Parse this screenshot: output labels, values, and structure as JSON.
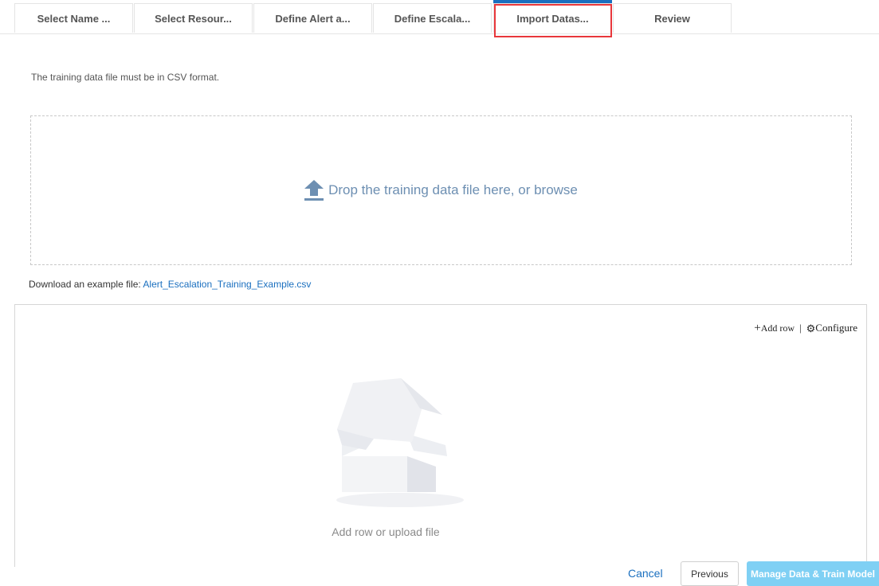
{
  "wizard": {
    "steps": [
      {
        "label": "Select Name ..."
      },
      {
        "label": "Select Resour..."
      },
      {
        "label": "Define Alert a..."
      },
      {
        "label": "Define Escala..."
      },
      {
        "label": "Import Datas..."
      },
      {
        "label": "Review"
      }
    ],
    "active_step": 5
  },
  "import": {
    "format_hint": "The training data file must be in CSV format.",
    "dropzone_text": "Drop the training data file here, or browse",
    "download_prefix": "Download an example file: ",
    "download_link": "Alert_Escalation_Training_Example.csv"
  },
  "grid": {
    "add_row_label": "Add row",
    "separator": "|",
    "configure_label": "Configure",
    "empty_text": "Add row or upload file"
  },
  "footer": {
    "cancel_label": "Cancel",
    "previous_label": "Previous",
    "primary_label": "Manage Data & Train Model"
  },
  "colors": {
    "accent": "#1a6fbf",
    "highlight": "#e8373b",
    "primary_button": "#7fd0f4",
    "dropzone_text": "#6d8fb2"
  },
  "icons": {
    "dropzone": "upload-icon",
    "add_row": "plus-icon",
    "configure": "gear-icon",
    "empty_state": "empty-box-icon"
  }
}
